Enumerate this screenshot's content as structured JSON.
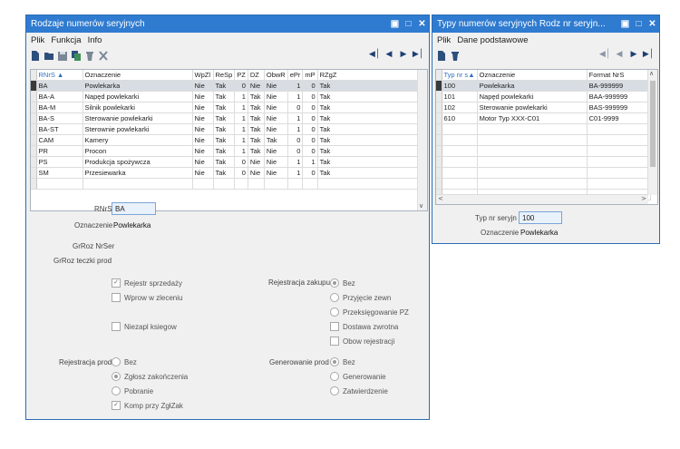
{
  "left": {
    "title": "Rodzaje numerów seryjnych",
    "menu": [
      "Plik",
      "Funkcja",
      "Info"
    ],
    "toolbar_icons": [
      "new-icon",
      "open-icon",
      "save-icon",
      "copy-icon",
      "delete-icon",
      "close-icon"
    ],
    "nav_icons": [
      "first-icon",
      "prev-icon",
      "next-icon",
      "last-icon"
    ],
    "columns": [
      "RNrS",
      "Oznaczenie",
      "WpZl",
      "ReSp",
      "PZ",
      "DZ",
      "ObwR",
      "ePr",
      "mP",
      "RZgZ"
    ],
    "rows": [
      [
        "BA",
        "Powlekarka",
        "Nie",
        "Tak",
        "0",
        "Nie",
        "Nie",
        "1",
        "0",
        "Tak"
      ],
      [
        "BA-A",
        "Napęd powlekarki",
        "Nie",
        "Tak",
        "1",
        "Tak",
        "Nie",
        "1",
        "0",
        "Tak"
      ],
      [
        "BA-M",
        "Silnik powlekarki",
        "Nie",
        "Tak",
        "1",
        "Tak",
        "Nie",
        "0",
        "0",
        "Tak"
      ],
      [
        "BA-S",
        "Sterowanie powlekarki",
        "Nie",
        "Tak",
        "1",
        "Tak",
        "Nie",
        "1",
        "0",
        "Tak"
      ],
      [
        "BA-ST",
        "Sterownie powlekarki",
        "Nie",
        "Tak",
        "1",
        "Tak",
        "Nie",
        "1",
        "0",
        "Tak"
      ],
      [
        "CAM",
        "Kamery",
        "Nie",
        "Tak",
        "1",
        "Tak",
        "Tak",
        "0",
        "0",
        "Tak"
      ],
      [
        "PR",
        "Procon",
        "Nie",
        "Tak",
        "1",
        "Tak",
        "Nie",
        "0",
        "0",
        "Tak"
      ],
      [
        "PS",
        "Produkcja spożywcza",
        "Nie",
        "Tak",
        "0",
        "Nie",
        "Nie",
        "1",
        "1",
        "Tak"
      ],
      [
        "SM",
        "Przesiewarka",
        "Nie",
        "Tak",
        "0",
        "Nie",
        "Nie",
        "1",
        "0",
        "Tak"
      ]
    ],
    "form": {
      "rnrs_label": "RNrS",
      "rnrs_value": "BA",
      "oznaczenie_label": "Oznaczenie",
      "oznaczenie_value": "Powlekarka",
      "grroz_label": "GrRoz NrSer",
      "grroz_teczki_label": "GrRoz teczki prod",
      "checks_left": [
        {
          "label": "Rejestr sprzedaży",
          "checked": true
        },
        {
          "label": "Wprow w zleceniu",
          "checked": false
        },
        {
          "label": "Niezapl ksiegow",
          "checked": false
        }
      ],
      "rejestracja_zakupu_label": "Rejestracja zakupu",
      "zakupu_options": [
        {
          "label": "Bez",
          "kind": "radio",
          "on": true
        },
        {
          "label": "Przyjęcie zewn",
          "kind": "radio",
          "on": false
        },
        {
          "label": "Przeksięgowanie PZ",
          "kind": "radio",
          "on": false
        },
        {
          "label": "Dostawa zwrotna",
          "kind": "check",
          "on": false
        },
        {
          "label": "Obow rejestracji",
          "kind": "check",
          "on": false
        }
      ],
      "rejestracja_prod_label": "Rejestracja prod",
      "prod_options": [
        {
          "label": "Bez",
          "kind": "radio",
          "on": false
        },
        {
          "label": "Zgłosz zakończenia",
          "kind": "radio",
          "on": true
        },
        {
          "label": "Pobranie",
          "kind": "radio",
          "on": false
        },
        {
          "label": "Komp przy ZgłZak",
          "kind": "check",
          "on": true
        }
      ],
      "generowanie_label": "Generowanie prod",
      "gen_options": [
        {
          "label": "Bez",
          "kind": "radio",
          "on": true
        },
        {
          "label": "Generowanie",
          "kind": "radio",
          "on": false
        },
        {
          "label": "Zatwierdzenie",
          "kind": "radio",
          "on": false
        }
      ]
    }
  },
  "right": {
    "title": "Typy numerów seryjnych Rodz nr seryjn...",
    "menu": [
      "Plik",
      "Dane podstawowe"
    ],
    "columns": [
      "Typ nr s",
      "Oznaczenie",
      "Format NrS"
    ],
    "rows": [
      [
        "100",
        "Powlekarka",
        "BA-999999"
      ],
      [
        "101",
        "Napęd powlekarki",
        "BAA-999999"
      ],
      [
        "102",
        "Sterowanie powlekarki",
        "BAS-999999"
      ],
      [
        "610",
        "Motor Typ XXX-C01",
        "C01-9999"
      ]
    ],
    "form": {
      "typ_label": "Typ nr seryjn",
      "typ_value": "100",
      "oznaczenie_label": "Oznaczenie",
      "oznaczenie_value": "Powlekarka"
    }
  }
}
